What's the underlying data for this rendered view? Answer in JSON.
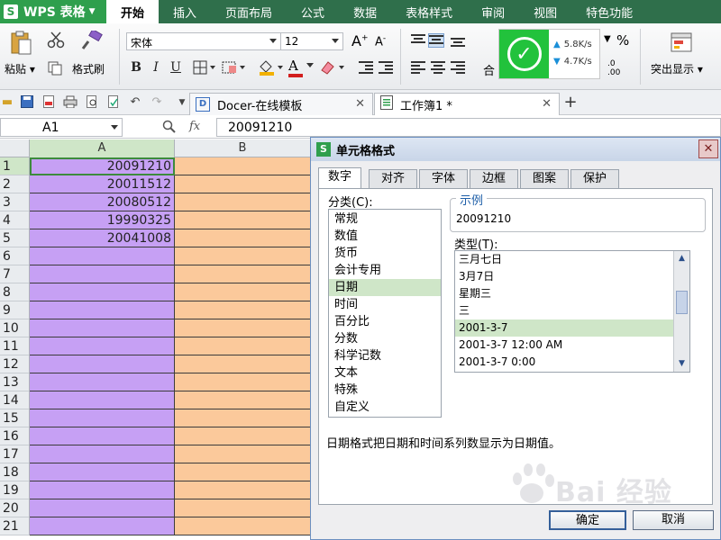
{
  "app": {
    "logo_label": "WPS 表格",
    "logo_letter": "S",
    "menu_tabs": [
      "开始",
      "插入",
      "页面布局",
      "公式",
      "数据",
      "表格样式",
      "审阅",
      "视图",
      "特色功能"
    ]
  },
  "ribbon": {
    "paste_label": "粘贴",
    "format_painter_label": "格式刷",
    "font_name": "宋体",
    "font_size": "12",
    "bold": "B",
    "italic": "I",
    "underline": "U",
    "font_color_glyph": "A",
    "grow_font": "A",
    "shrink_font": "A",
    "merge_label": "合",
    "percent": "%",
    "decimals_increase": ".00",
    "decimals_decrease": ".0",
    "highlight_label": "突出显示",
    "speed": {
      "upload": "5.8K/s",
      "download": "4.7K/s"
    }
  },
  "toolbar": {
    "tabs": [
      {
        "label": "Docer-在线模板",
        "icon_letter": "D"
      },
      {
        "label": "工作簿1 *",
        "icon_letter": ""
      }
    ],
    "add_tab": "+"
  },
  "formula_bar": {
    "name_box": "A1",
    "fx": "fx",
    "value": "20091210"
  },
  "sheet": {
    "columns": [
      "A",
      "B"
    ],
    "rows": [
      {
        "num": "1",
        "a": "20091210"
      },
      {
        "num": "2",
        "a": "20011512"
      },
      {
        "num": "3",
        "a": "20080512"
      },
      {
        "num": "4",
        "a": "19990325"
      },
      {
        "num": "5",
        "a": "20041008"
      },
      {
        "num": "6",
        "a": ""
      },
      {
        "num": "7",
        "a": ""
      },
      {
        "num": "8",
        "a": ""
      },
      {
        "num": "9",
        "a": ""
      },
      {
        "num": "10",
        "a": ""
      },
      {
        "num": "11",
        "a": ""
      },
      {
        "num": "12",
        "a": ""
      },
      {
        "num": "13",
        "a": ""
      },
      {
        "num": "14",
        "a": ""
      },
      {
        "num": "15",
        "a": ""
      },
      {
        "num": "16",
        "a": ""
      },
      {
        "num": "17",
        "a": ""
      },
      {
        "num": "18",
        "a": ""
      },
      {
        "num": "19",
        "a": ""
      },
      {
        "num": "20",
        "a": ""
      },
      {
        "num": "21",
        "a": ""
      }
    ],
    "colors": {
      "col_a": "#c6a0f4",
      "col_b": "#fbc99b"
    }
  },
  "dialog": {
    "title": "单元格格式",
    "close": "✕",
    "tabs": [
      "数字",
      "对齐",
      "字体",
      "边框",
      "图案",
      "保护"
    ],
    "category_label": "分类(C):",
    "categories": [
      "常规",
      "数值",
      "货币",
      "会计专用",
      "日期",
      "时间",
      "百分比",
      "分数",
      "科学记数",
      "文本",
      "特殊",
      "自定义"
    ],
    "selected_category": "日期",
    "sample_label": "示例",
    "sample_value": "20091210",
    "type_label": "类型(T):",
    "types": [
      "三月七日",
      "3月7日",
      "星期三",
      "三",
      "2001-3-7",
      "2001-3-7 12:00 AM",
      "2001-3-7 0:00"
    ],
    "selected_type": "2001-3-7",
    "description": "日期格式把日期和时间系列数显示为日期值。",
    "ok": "确定",
    "cancel": "取消"
  },
  "watermark": "Bai 经验"
}
